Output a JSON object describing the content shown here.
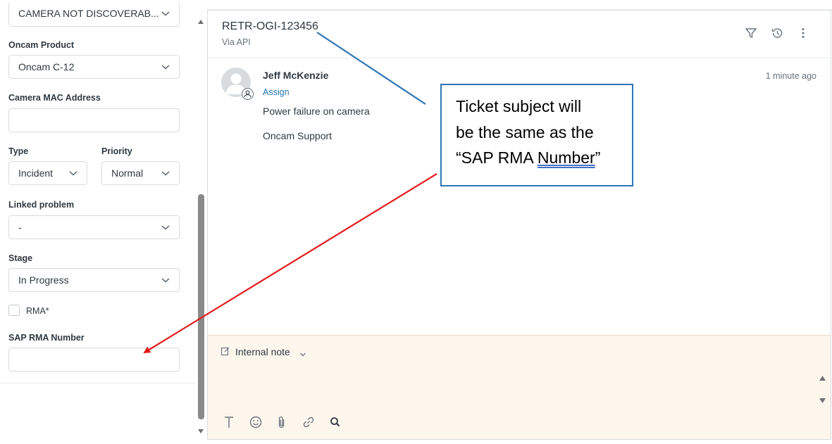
{
  "sidebar": {
    "top_dropdown": {
      "value": "CAMERA NOT DISCOVERAB..."
    },
    "oncam_product": {
      "label": "Oncam Product",
      "value": "Oncam C-12"
    },
    "camera_mac": {
      "label": "Camera MAC Address",
      "value": ""
    },
    "type": {
      "label": "Type",
      "value": "Incident"
    },
    "priority": {
      "label": "Priority",
      "value": "Normal"
    },
    "linked_problem": {
      "label": "Linked problem",
      "value": "-"
    },
    "stage": {
      "label": "Stage",
      "value": "In Progress"
    },
    "rma": {
      "label": "RMA*",
      "checked": false
    },
    "sap_rma": {
      "label": "SAP RMA Number",
      "value": ""
    }
  },
  "ticket": {
    "id": "RETR-OGI-123456",
    "via": "Via API",
    "header_icons": [
      "filter-icon",
      "history-icon",
      "more-options-icon"
    ]
  },
  "message": {
    "author": "Jeff McKenzie",
    "assign": "Assign",
    "line1": "Power failure on camera",
    "line2": "Oncam Support",
    "time": "1 minute ago"
  },
  "composer": {
    "note_type": "Internal note",
    "toolbar_icons": [
      "text-format-icon",
      "emoji-icon",
      "attachment-icon",
      "link-icon",
      "search-icon"
    ]
  },
  "annotation": {
    "line1": "Ticket subject will",
    "line2": "be the same as the",
    "line3_prefix": "“SAP RMA ",
    "line3_underlined": "Number",
    "line3_suffix": "”",
    "colors": {
      "box_border": "#2e75b6",
      "blue_arrow": "#2e75b6",
      "red_arrow": "#e31b1b"
    }
  }
}
